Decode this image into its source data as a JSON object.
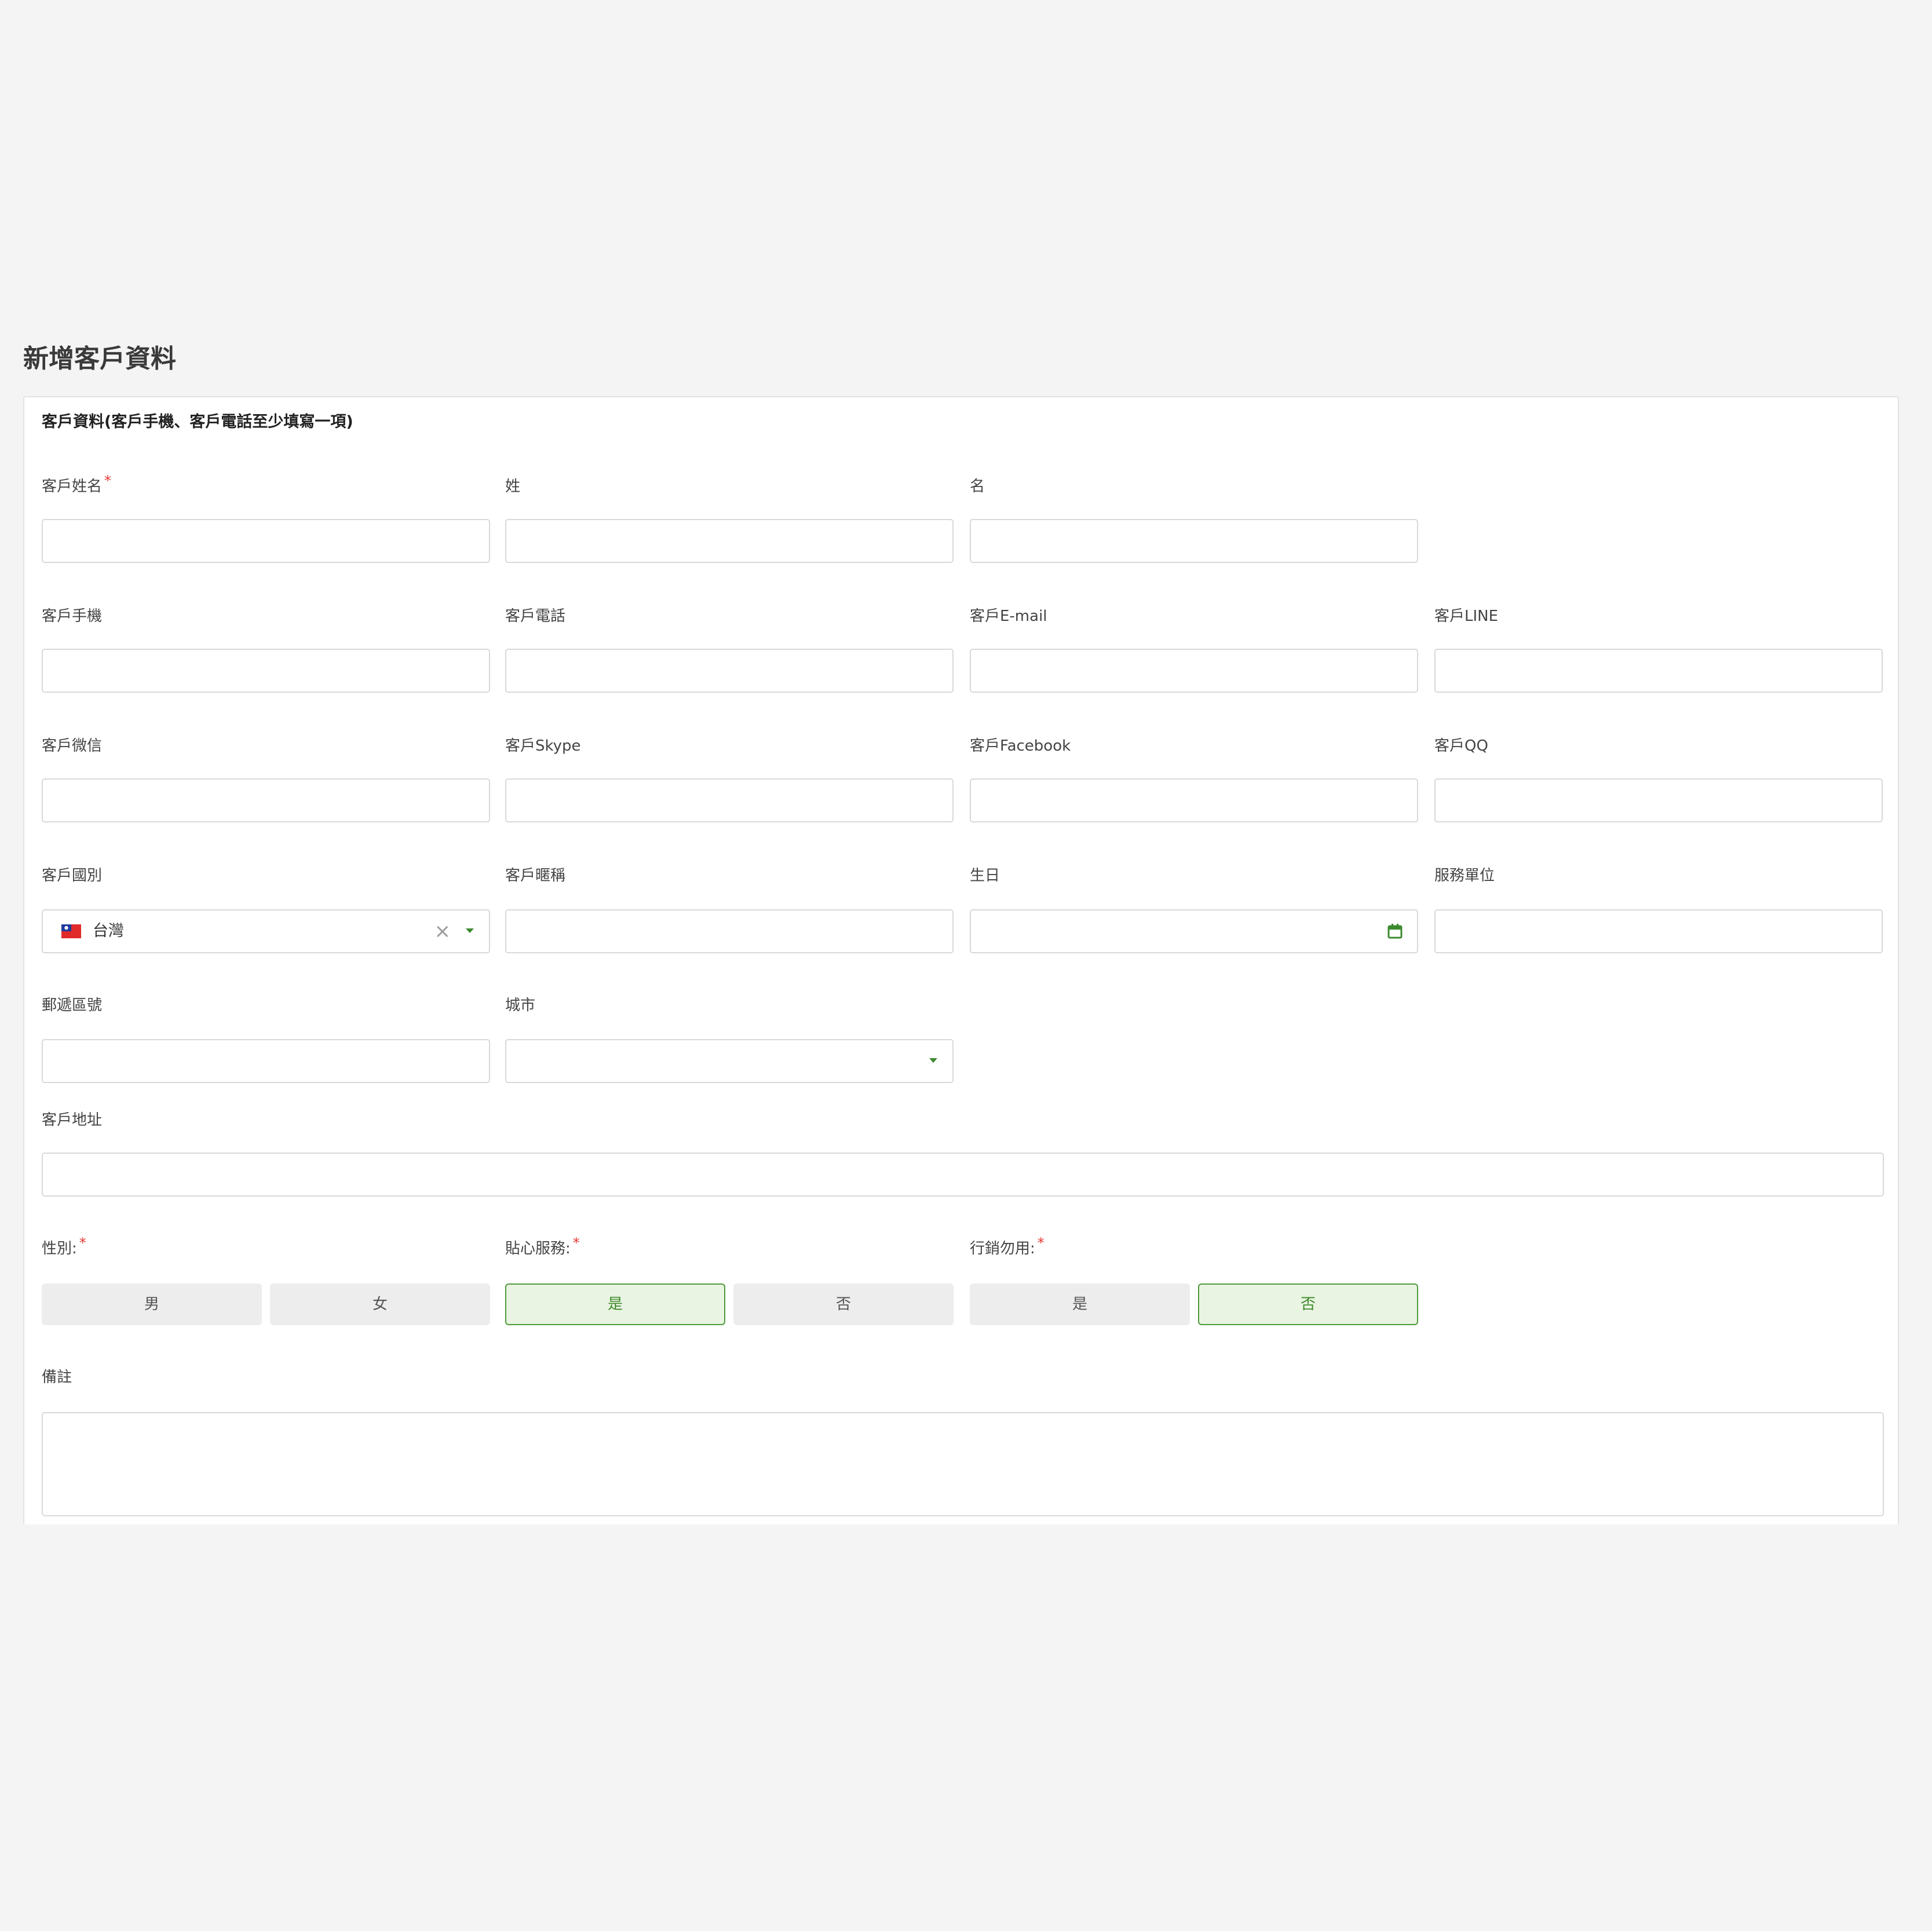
{
  "page": {
    "title": "新增客戶資料"
  },
  "section": {
    "title": "客戶資料(客戶手機、客戶電話至少填寫一項)"
  },
  "required_marker": "*",
  "fields": {
    "customer_name": {
      "label": "客戶姓名",
      "value": ""
    },
    "last_name": {
      "label": "姓",
      "value": ""
    },
    "first_name": {
      "label": "名",
      "value": ""
    },
    "mobile": {
      "label": "客戶手機",
      "value": ""
    },
    "phone": {
      "label": "客戶電話",
      "value": ""
    },
    "email": {
      "label": "客戶E-mail",
      "value": ""
    },
    "line": {
      "label": "客戶LINE",
      "value": ""
    },
    "wechat": {
      "label": "客戶微信",
      "value": ""
    },
    "skype": {
      "label": "客戶Skype",
      "value": ""
    },
    "facebook": {
      "label": "客戶Facebook",
      "value": ""
    },
    "qq": {
      "label": "客戶QQ",
      "value": ""
    },
    "country": {
      "label": "客戶國別",
      "value": "台灣",
      "flag_icon": "taiwan-flag-icon"
    },
    "nickname": {
      "label": "客戶暱稱",
      "value": ""
    },
    "birthday": {
      "label": "生日",
      "value": ""
    },
    "workplace": {
      "label": "服務單位",
      "value": ""
    },
    "postal_code": {
      "label": "郵遞區號",
      "value": ""
    },
    "city": {
      "label": "城市",
      "value": ""
    },
    "address": {
      "label": "客戶地址",
      "value": ""
    },
    "gender": {
      "label": "性別:",
      "options": [
        "男",
        "女"
      ],
      "selected": null
    },
    "care_service": {
      "label": "貼心服務:",
      "options": [
        "是",
        "否"
      ],
      "selected": "是"
    },
    "marketing_opt_out": {
      "label": "行銷勿用:",
      "options": [
        "是",
        "否"
      ],
      "selected": "否"
    },
    "notes": {
      "label": "備註",
      "value": ""
    }
  },
  "colors": {
    "accent_green": "#4e9a3b",
    "active_fill": "#e9f4e2",
    "required_red": "#e53935",
    "page_background": "#f4f4f4"
  }
}
